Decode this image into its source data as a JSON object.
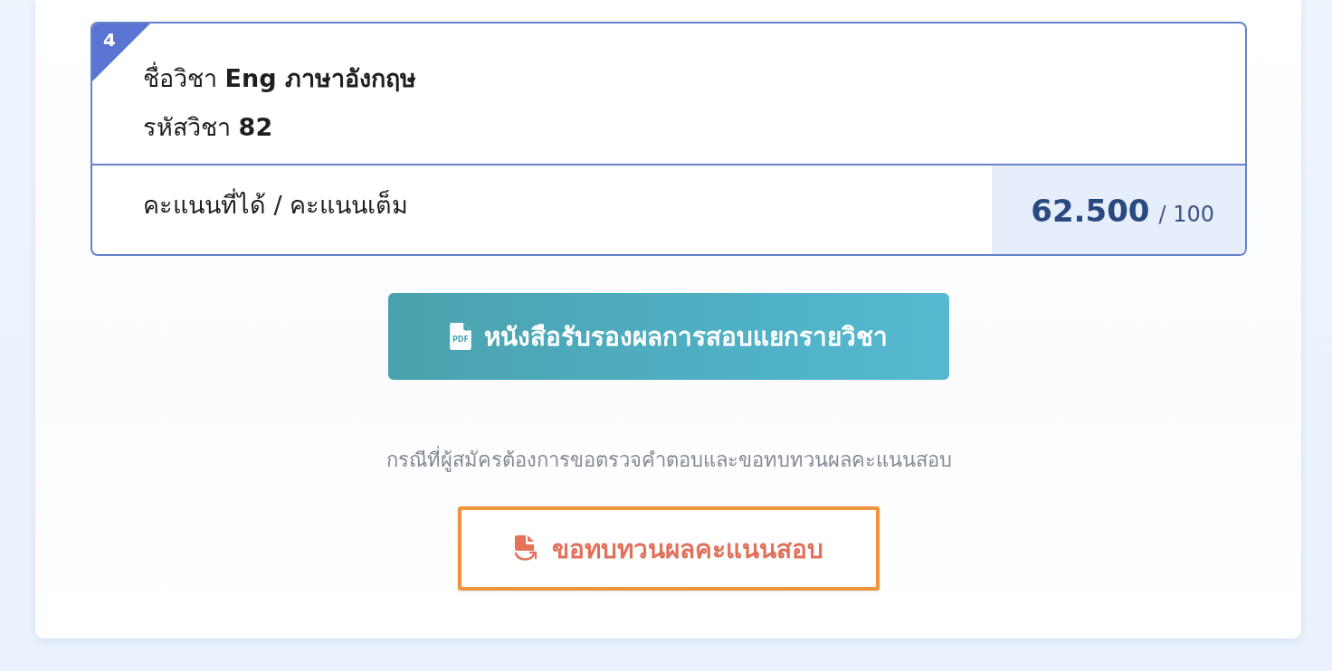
{
  "subject": {
    "number": "4",
    "title": "ชื่อวิชา **Eng ภาษาอังกฤษ**",
    "code": "รหัสวิชา **82**",
    "score_label": "คะแนนที่ได้ / คะแนนเต็ม",
    "score": "62.500",
    "full_score": "/ 100"
  },
  "certificate_button": {
    "icon_text": "PDF",
    "label": "หนังสือรับรองผลการสอบแยกรายวิชา"
  },
  "review_note": "กรณีที่ผู้สมัครต้องการขอตรวจคำตอบและขอทบทวนผลคะแนนสอบ",
  "review_button": {
    "label": "ขอทบทวนผลคะแนนสอบ",
    "highlighted": true
  }
}
